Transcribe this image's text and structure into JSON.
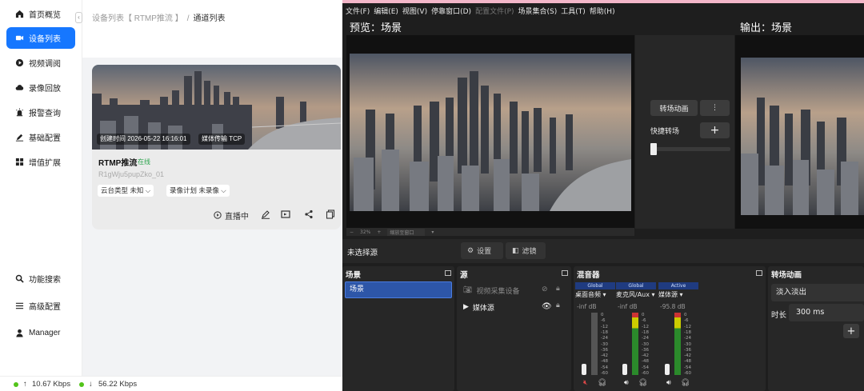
{
  "sidebar": {
    "items": [
      {
        "label": "首页概览",
        "icon": "home-icon"
      },
      {
        "label": "设备列表",
        "icon": "camera-icon",
        "active": true
      },
      {
        "label": "视频调阅",
        "icon": "play-circle-icon"
      },
      {
        "label": "录像回放",
        "icon": "cloud-icon"
      },
      {
        "label": "报警查询",
        "icon": "alarm-icon"
      },
      {
        "label": "基础配置",
        "icon": "edit-icon"
      },
      {
        "label": "增值扩展",
        "icon": "apps-icon"
      }
    ],
    "bottom": [
      {
        "label": "功能搜索",
        "icon": "search-icon"
      },
      {
        "label": "高级配置",
        "icon": "menu-icon"
      },
      {
        "label": "Manager",
        "icon": "user-icon"
      }
    ]
  },
  "breadcrumb": {
    "parent": "设备列表【 RTMP推流 】",
    "separator": "/",
    "current": "通道列表"
  },
  "card": {
    "created": "创建时间 2026-05-22 16:16:01",
    "transport": "媒体传输 TCP",
    "name": "RTMP推流",
    "status": "在线",
    "id": "R1gWju5pupZko_01",
    "ptz": "云台类型 未知",
    "record": "录像计划 未录像",
    "live": "直播中"
  },
  "statusbar": {
    "up": "10.67 Kbps",
    "down": "56.22 Kbps"
  },
  "obs": {
    "menu": [
      "文件(F)",
      "编辑(E)",
      "视图(V)",
      "停靠窗口(D)",
      "配置文件(P)",
      "场景集合(S)",
      "工具(T)",
      "帮助(H)"
    ],
    "preview_title": "预览：场景",
    "output_title": "输出：场景",
    "transition_btn": "转场动画",
    "quick_transition": "快捷转场",
    "zoom": "32%",
    "zoom_mode": "缩放至窗口",
    "no_source": "未选择源",
    "settings_btn": "设置",
    "filters_btn": "滤镜",
    "docks": {
      "scenes": {
        "title": "场景",
        "items": [
          "场景"
        ]
      },
      "sources": {
        "title": "源",
        "items": [
          "视频采集设备",
          "媒体源"
        ]
      },
      "mixer": {
        "title": "混音器",
        "channels": [
          {
            "tag": "Global",
            "name": "桌面音频",
            "db": "-inf dB",
            "muted": true
          },
          {
            "tag": "Global",
            "name": "麦克风/Aux",
            "db": "-inf dB",
            "muted": false
          },
          {
            "tag": "Active",
            "name": "媒体源",
            "db": "-95.8 dB",
            "muted": false
          }
        ],
        "scale": [
          "0",
          "-6",
          "-12",
          "-18",
          "-24",
          "-30",
          "-36",
          "-42",
          "-48",
          "-54",
          "-60"
        ]
      },
      "transitions": {
        "title": "转场动画",
        "selected": "淡入淡出",
        "duration_label": "时长",
        "duration": "300 ms"
      }
    }
  }
}
